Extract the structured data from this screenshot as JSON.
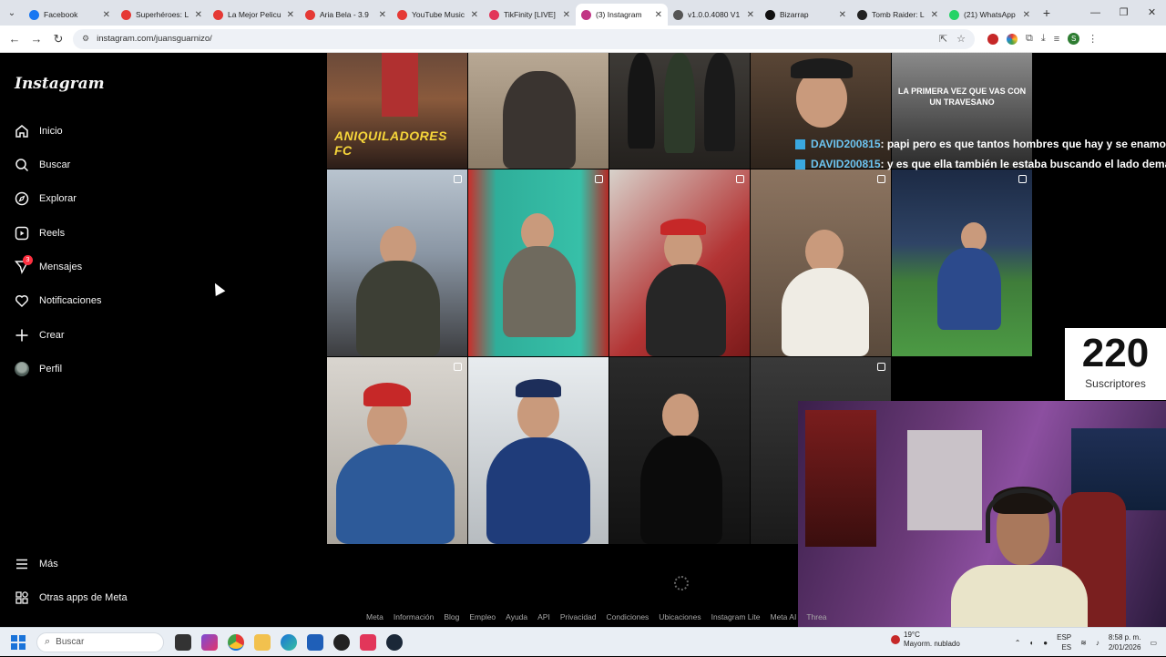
{
  "browser": {
    "tabs": [
      {
        "title": "Facebook",
        "color": "#1877f2"
      },
      {
        "title": "Superhéroes: L",
        "color": "#e53935"
      },
      {
        "title": "La Mejor Pelicu",
        "color": "#e53935"
      },
      {
        "title": "Aria Bela - 3.9",
        "color": "#e53935"
      },
      {
        "title": "YouTube Music",
        "color": "#e53935"
      },
      {
        "title": "TikFinity [LIVE]",
        "color": "#e2365a"
      },
      {
        "title": "(3) Instagram",
        "color": "#c13584",
        "active": true
      },
      {
        "title": "v1.0.0.4080 V1",
        "color": "#555555"
      },
      {
        "title": "Bizarrap",
        "color": "#111111"
      },
      {
        "title": "Tomb Raider: L",
        "color": "#222222"
      },
      {
        "title": "(21) WhatsApp",
        "color": "#25d366"
      }
    ],
    "url": "instagram.com/juansguarnizo/"
  },
  "sidebar": {
    "logo": "Instagram",
    "items": [
      {
        "label": "Inicio",
        "icon": "home-icon"
      },
      {
        "label": "Buscar",
        "icon": "search-icon"
      },
      {
        "label": "Explorar",
        "icon": "compass-icon"
      },
      {
        "label": "Reels",
        "icon": "reels-icon"
      },
      {
        "label": "Mensajes",
        "icon": "messenger-icon",
        "badge": "3"
      },
      {
        "label": "Notificaciones",
        "icon": "heart-icon"
      },
      {
        "label": "Crear",
        "icon": "plus-icon"
      },
      {
        "label": "Perfil",
        "icon": "avatar"
      }
    ],
    "bottom": [
      {
        "label": "Más",
        "icon": "menu-icon"
      },
      {
        "label": "Otras apps de Meta",
        "icon": "apps-icon"
      }
    ]
  },
  "grid": {
    "row0_texts": {
      "aniquiladores": "ANIQUILADORES FC",
      "caption": "LA PRIMERA VEZ QUE VAS CON UN TRAVESANO"
    }
  },
  "chat": [
    {
      "user": "DAVID200815",
      "text": " : papi pero es que tantos hombres que hay y se enamora"
    },
    {
      "user": "DAVID200815",
      "text": " : y es que ella también le estaba buscando el lado dema"
    }
  ],
  "subscribers": {
    "count": "220",
    "label": "Suscriptores"
  },
  "footer": [
    "Meta",
    "Información",
    "Blog",
    "Empleo",
    "Ayuda",
    "API",
    "Privacidad",
    "Condiciones",
    "Ubicaciones",
    "Instagram Lite",
    "Meta AI",
    "Threa"
  ],
  "taskbar": {
    "search_placeholder": "Buscar",
    "weather_temp": "19°C",
    "weather_desc": "Mayorm. nublado",
    "lang": "ESP",
    "lang_sub": "ES",
    "time": "8:58 p. m.",
    "date": "2/01/2026"
  }
}
